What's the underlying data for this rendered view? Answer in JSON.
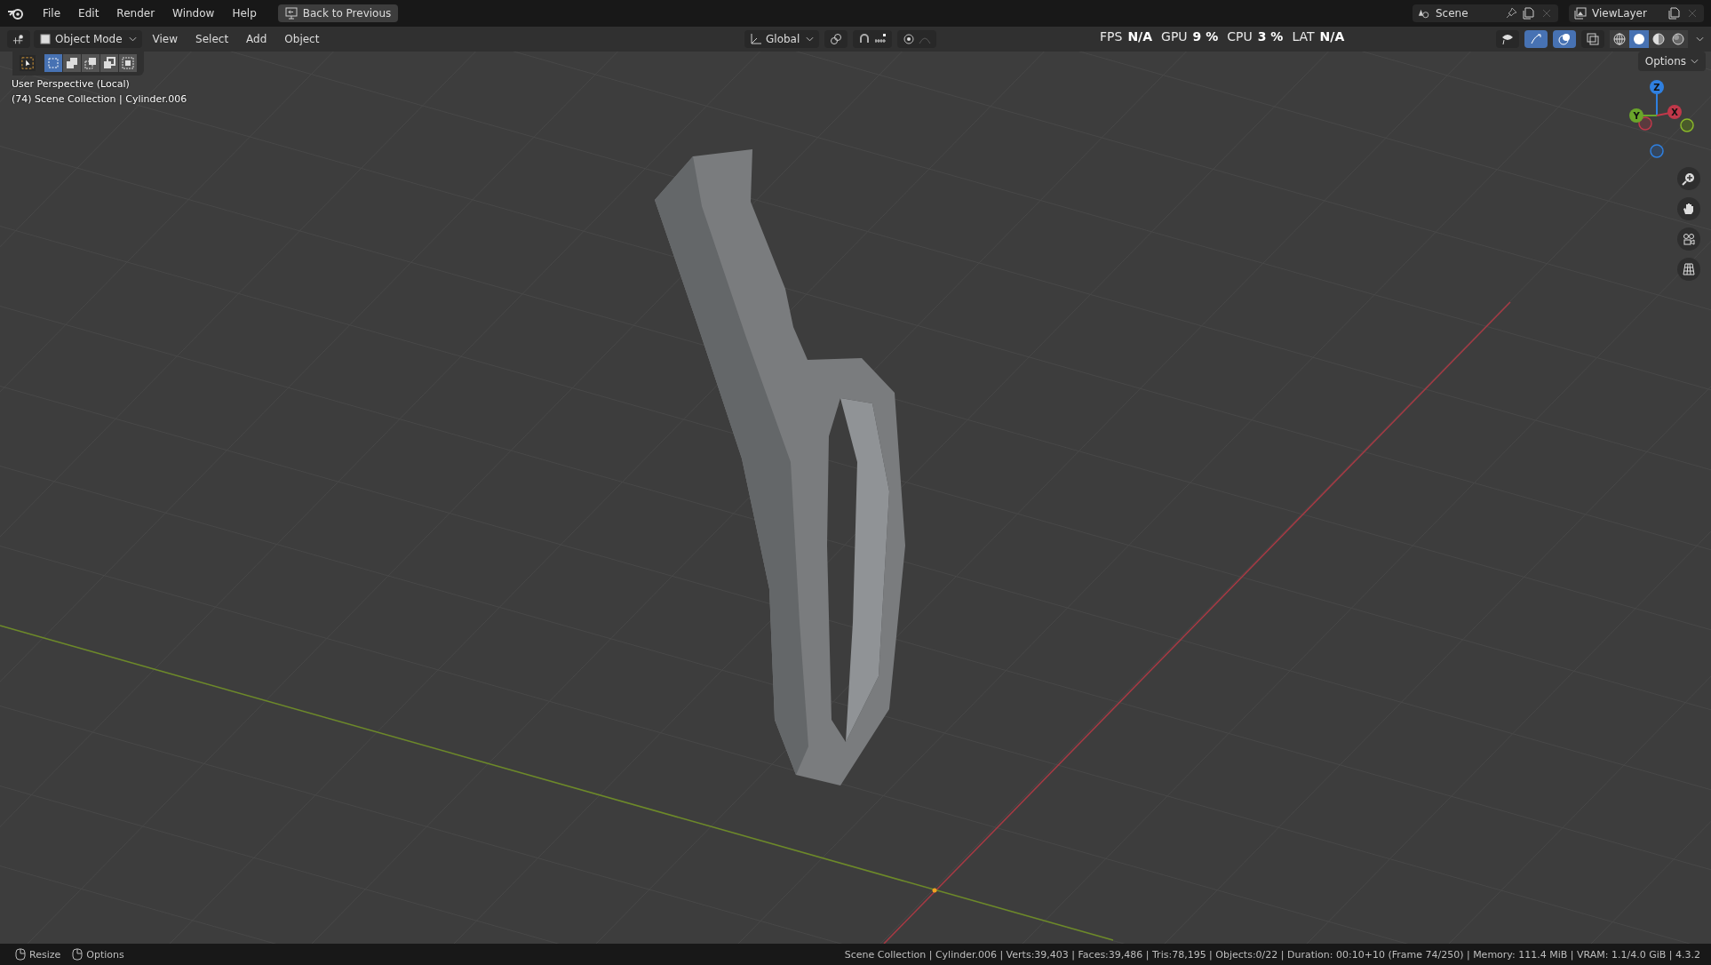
{
  "menu_bar": {
    "menus": [
      "File",
      "Edit",
      "Render",
      "Window",
      "Help"
    ],
    "back_button": "Back to Previous",
    "scene": "Scene",
    "view_layer": "ViewLayer"
  },
  "header": {
    "mode": "Object Mode",
    "menus": [
      "View",
      "Select",
      "Add",
      "Object"
    ],
    "orientation": "Global",
    "stats": [
      {
        "label": "FPS",
        "value": "N/A"
      },
      {
        "label": "GPU",
        "value": "9 %"
      },
      {
        "label": "CPU",
        "value": "3 %"
      },
      {
        "label": "LAT",
        "value": "N/A"
      }
    ],
    "shading": [
      {
        "kind": "wireframe",
        "selected": false
      },
      {
        "kind": "solid",
        "selected": true
      },
      {
        "kind": "material",
        "selected": false
      },
      {
        "kind": "rendered",
        "selected": false
      }
    ]
  },
  "toolbar": {
    "select_modes": [
      {
        "kind": "new",
        "selected": true
      },
      {
        "kind": "extend",
        "selected": false
      },
      {
        "kind": "subtract",
        "selected": false
      },
      {
        "kind": "difference",
        "selected": false
      },
      {
        "kind": "intersect",
        "selected": false
      }
    ],
    "options_button": "Options"
  },
  "viewport": {
    "view_name": "User Perspective (Local)",
    "collection": "(74) Scene Collection | Cylinder.006"
  },
  "gizmo": {
    "axes": [
      {
        "label": "Z",
        "color": "#2f80e0"
      },
      {
        "label": "Y",
        "color": "#6aa52a"
      },
      {
        "label": "X",
        "color": "#c0384a"
      }
    ]
  },
  "status_bar": {
    "hints": [
      "Resize",
      "Options"
    ],
    "stats": "Scene Collection | Cylinder.006 | Verts:39,403 | Faces:39,486 | Tris:78,195 | Objects:0/22 | Duration: 00:10+10 (Frame 74/250) | Memory: 111.4 MiB | VRAM: 1.1/4.0 GiB | 4.3.2"
  }
}
